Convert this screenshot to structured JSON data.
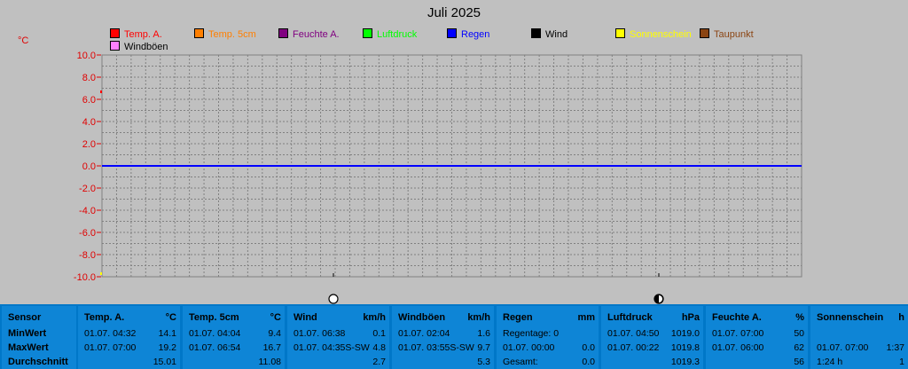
{
  "chart_data": {
    "type": "line",
    "title": "Juli 2025",
    "ylabel": "°C",
    "yticks": [
      "10.0",
      "8.0",
      "6.0",
      "4.0",
      "2.0",
      "0.0",
      "-2.0",
      "-4.0",
      "-6.0",
      "-8.0",
      "-10.0"
    ],
    "ylim": [
      -10,
      10
    ],
    "grid": true,
    "legend": [
      {
        "name": "Temp. A.",
        "color": "#ff0000"
      },
      {
        "name": "Temp. 5cm",
        "color": "#ff7f00"
      },
      {
        "name": "Feuchte A.",
        "color": "#800080"
      },
      {
        "name": "Luftdruck",
        "color": "#00ff00"
      },
      {
        "name": "Regen",
        "color": "#0000ff"
      },
      {
        "name": "Wind",
        "color": "#000000"
      },
      {
        "name": "Sonnenschein",
        "color": "#ffff00"
      },
      {
        "name": "Taupunkt",
        "color": "#8b4513"
      },
      {
        "name": "Windböen",
        "color": "#ff80ff"
      }
    ],
    "series": [
      {
        "name": "Regen",
        "color": "#0000ff",
        "x": [
          0,
          1
        ],
        "values": [
          0.0,
          0.0
        ]
      }
    ]
  },
  "stats": {
    "sensor": {
      "header": "Sensor",
      "min": "MinWert",
      "max": "MaxWert",
      "avg": "Durchschnitt"
    },
    "temp_a": {
      "name": "Temp. A.",
      "unit": "°C",
      "min_time": "01.07.  04:32",
      "min_val": "14.1",
      "max_time": "01.07.  07:00",
      "max_val": "19.2",
      "avg": "15.01"
    },
    "temp_5cm": {
      "name": "Temp. 5cm",
      "unit": "°C",
      "min_time": "01.07.  04:04",
      "min_val": "9.4",
      "max_time": "01.07.  06:54",
      "max_val": "16.7",
      "avg": "11.08"
    },
    "wind": {
      "name": "Wind",
      "unit": "km/h",
      "min_time": "01.07.  06:38",
      "min_val": "0.1",
      "max_time": "01.07.  04:35S-SW",
      "max_val": "4.8",
      "avg": "2.7"
    },
    "windboeen": {
      "name": "Windböen",
      "unit": "km/h",
      "min_time": "01.07.  02:04",
      "min_val": "1.6",
      "max_time": "01.07.  03:55S-SW",
      "max_val": "9.7",
      "avg": "5.3"
    },
    "regen": {
      "name": "Regen",
      "unit": "mm",
      "row1": "Regentage: 0",
      "max_time": "01.07.  00:00",
      "max_val": "0.0",
      "total_label": "Gesamt:",
      "total": "0.0"
    },
    "luftdruck": {
      "name": "Luftdruck",
      "unit": "hPa",
      "min_time": "01.07.  04:50",
      "min_val": "1019.0",
      "max_time": "01.07.  00:22",
      "max_val": "1019.8",
      "avg": "1019.3"
    },
    "feuchte": {
      "name": "Feuchte A.",
      "unit": "%",
      "min_time": "01.07.  07:00",
      "min_val": "50",
      "max_time": "01.07.  06:00",
      "max_val": "62",
      "avg": "56"
    },
    "sonne": {
      "name": "Sonnenschein",
      "unit": "h",
      "max_time": "01.07.  07:00",
      "max_val": "1:37",
      "avg_label": "1:24 h",
      "avg": "1"
    }
  }
}
